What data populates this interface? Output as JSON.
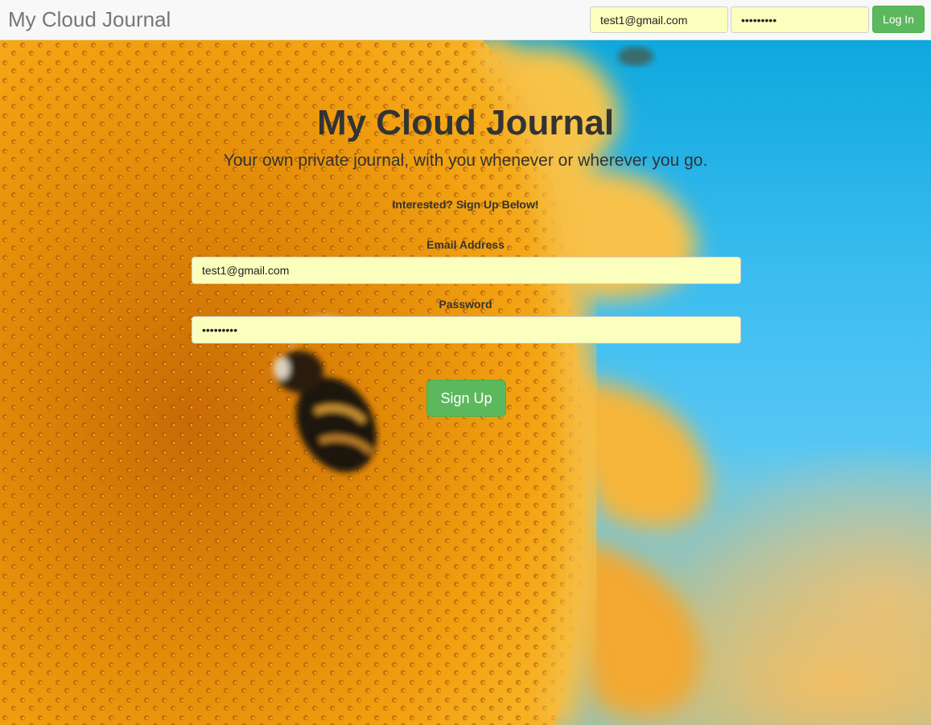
{
  "navbar": {
    "brand": "My Cloud Journal",
    "login_email_value": "test1@gmail.com",
    "login_password_value": "•••••••••",
    "login_button": "Log In"
  },
  "hero": {
    "title": "My Cloud Journal",
    "subtitle": "Your own private journal, with you whenever or wherever you go.",
    "signup_prompt": "Interested? Sign Up Below!"
  },
  "signup_form": {
    "email_label": "Email Address",
    "email_value": "test1@gmail.com",
    "password_label": "Password",
    "password_value": "•••••••••",
    "submit_label": "Sign Up"
  },
  "colors": {
    "button_green": "#5cb85c",
    "autofill_yellow": "#fbffbd",
    "sky_blue": "#3cbdf0",
    "sunflower_orange": "#f4a10f"
  },
  "background_image": "sunflower-with-bee-photo"
}
